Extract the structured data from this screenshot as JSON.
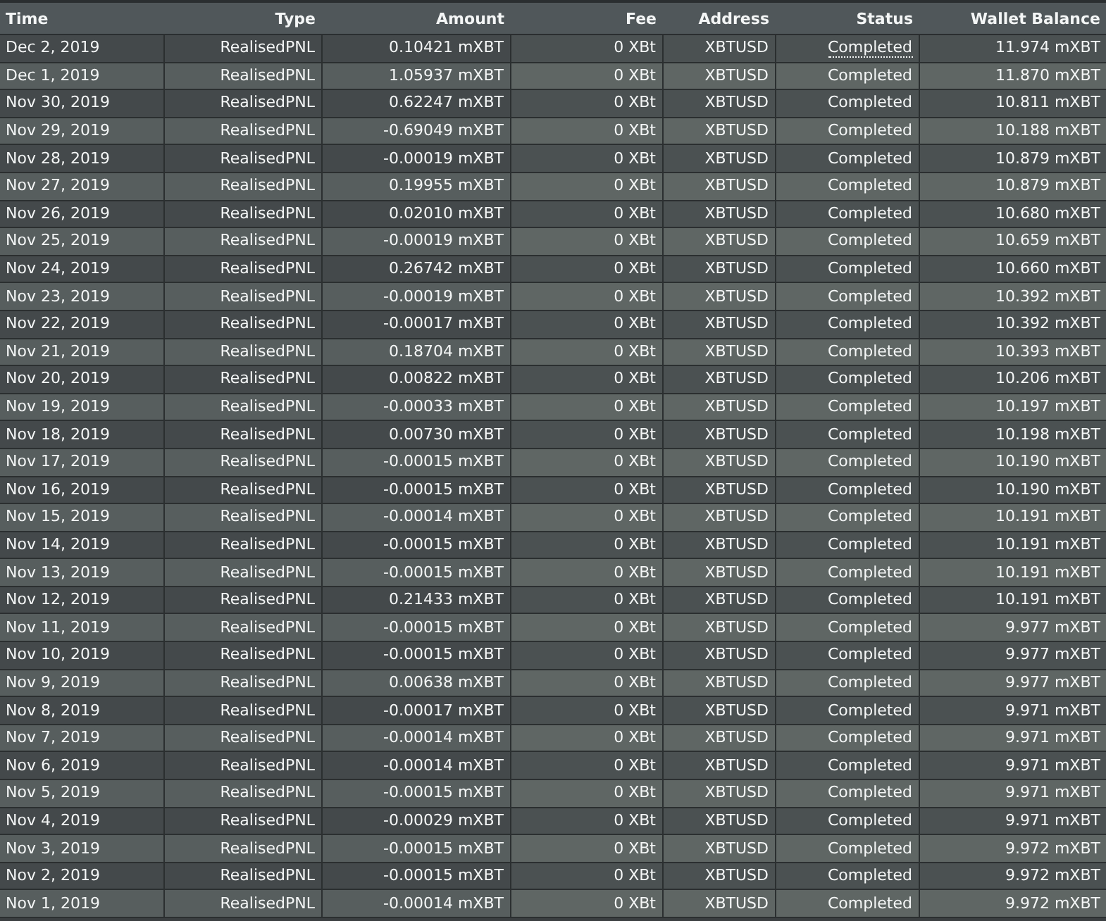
{
  "table": {
    "columns": [
      "Time",
      "Type",
      "Amount",
      "Fee",
      "Address",
      "Status",
      "Wallet Balance"
    ],
    "rows": [
      {
        "cells": [
          "Dec 2, 2019",
          "RealisedPNL",
          "0.10421 mXBT",
          "0 XBt",
          "XBTUSD",
          "Completed",
          "11.974 mXBT"
        ],
        "hovered": true
      },
      {
        "cells": [
          "Dec 1, 2019",
          "RealisedPNL",
          "1.05937 mXBT",
          "0 XBt",
          "XBTUSD",
          "Completed",
          "11.870 mXBT"
        ],
        "hovered": false
      },
      {
        "cells": [
          "Nov 30, 2019",
          "RealisedPNL",
          "0.62247 mXBT",
          "0 XBt",
          "XBTUSD",
          "Completed",
          "10.811 mXBT"
        ],
        "hovered": false
      },
      {
        "cells": [
          "Nov 29, 2019",
          "RealisedPNL",
          "-0.69049 mXBT",
          "0 XBt",
          "XBTUSD",
          "Completed",
          "10.188 mXBT"
        ],
        "hovered": false
      },
      {
        "cells": [
          "Nov 28, 2019",
          "RealisedPNL",
          "-0.00019 mXBT",
          "0 XBt",
          "XBTUSD",
          "Completed",
          "10.879 mXBT"
        ],
        "hovered": false
      },
      {
        "cells": [
          "Nov 27, 2019",
          "RealisedPNL",
          "0.19955 mXBT",
          "0 XBt",
          "XBTUSD",
          "Completed",
          "10.879 mXBT"
        ],
        "hovered": false
      },
      {
        "cells": [
          "Nov 26, 2019",
          "RealisedPNL",
          "0.02010 mXBT",
          "0 XBt",
          "XBTUSD",
          "Completed",
          "10.680 mXBT"
        ],
        "hovered": false
      },
      {
        "cells": [
          "Nov 25, 2019",
          "RealisedPNL",
          "-0.00019 mXBT",
          "0 XBt",
          "XBTUSD",
          "Completed",
          "10.659 mXBT"
        ],
        "hovered": false
      },
      {
        "cells": [
          "Nov 24, 2019",
          "RealisedPNL",
          "0.26742 mXBT",
          "0 XBt",
          "XBTUSD",
          "Completed",
          "10.660 mXBT"
        ],
        "hovered": false
      },
      {
        "cells": [
          "Nov 23, 2019",
          "RealisedPNL",
          "-0.00019 mXBT",
          "0 XBt",
          "XBTUSD",
          "Completed",
          "10.392 mXBT"
        ],
        "hovered": false
      },
      {
        "cells": [
          "Nov 22, 2019",
          "RealisedPNL",
          "-0.00017 mXBT",
          "0 XBt",
          "XBTUSD",
          "Completed",
          "10.392 mXBT"
        ],
        "hovered": false
      },
      {
        "cells": [
          "Nov 21, 2019",
          "RealisedPNL",
          "0.18704 mXBT",
          "0 XBt",
          "XBTUSD",
          "Completed",
          "10.393 mXBT"
        ],
        "hovered": false
      },
      {
        "cells": [
          "Nov 20, 2019",
          "RealisedPNL",
          "0.00822 mXBT",
          "0 XBt",
          "XBTUSD",
          "Completed",
          "10.206 mXBT"
        ],
        "hovered": false
      },
      {
        "cells": [
          "Nov 19, 2019",
          "RealisedPNL",
          "-0.00033 mXBT",
          "0 XBt",
          "XBTUSD",
          "Completed",
          "10.197 mXBT"
        ],
        "hovered": false
      },
      {
        "cells": [
          "Nov 18, 2019",
          "RealisedPNL",
          "0.00730 mXBT",
          "0 XBt",
          "XBTUSD",
          "Completed",
          "10.198 mXBT"
        ],
        "hovered": false
      },
      {
        "cells": [
          "Nov 17, 2019",
          "RealisedPNL",
          "-0.00015 mXBT",
          "0 XBt",
          "XBTUSD",
          "Completed",
          "10.190 mXBT"
        ],
        "hovered": false
      },
      {
        "cells": [
          "Nov 16, 2019",
          "RealisedPNL",
          "-0.00015 mXBT",
          "0 XBt",
          "XBTUSD",
          "Completed",
          "10.190 mXBT"
        ],
        "hovered": false
      },
      {
        "cells": [
          "Nov 15, 2019",
          "RealisedPNL",
          "-0.00014 mXBT",
          "0 XBt",
          "XBTUSD",
          "Completed",
          "10.191 mXBT"
        ],
        "hovered": false
      },
      {
        "cells": [
          "Nov 14, 2019",
          "RealisedPNL",
          "-0.00015 mXBT",
          "0 XBt",
          "XBTUSD",
          "Completed",
          "10.191 mXBT"
        ],
        "hovered": false
      },
      {
        "cells": [
          "Nov 13, 2019",
          "RealisedPNL",
          "-0.00015 mXBT",
          "0 XBt",
          "XBTUSD",
          "Completed",
          "10.191 mXBT"
        ],
        "hovered": false
      },
      {
        "cells": [
          "Nov 12, 2019",
          "RealisedPNL",
          "0.21433 mXBT",
          "0 XBt",
          "XBTUSD",
          "Completed",
          "10.191 mXBT"
        ],
        "hovered": false
      },
      {
        "cells": [
          "Nov 11, 2019",
          "RealisedPNL",
          "-0.00015 mXBT",
          "0 XBt",
          "XBTUSD",
          "Completed",
          "9.977 mXBT"
        ],
        "hovered": false
      },
      {
        "cells": [
          "Nov 10, 2019",
          "RealisedPNL",
          "-0.00015 mXBT",
          "0 XBt",
          "XBTUSD",
          "Completed",
          "9.977 mXBT"
        ],
        "hovered": false
      },
      {
        "cells": [
          "Nov 9, 2019",
          "RealisedPNL",
          "0.00638 mXBT",
          "0 XBt",
          "XBTUSD",
          "Completed",
          "9.977 mXBT"
        ],
        "hovered": false
      },
      {
        "cells": [
          "Nov 8, 2019",
          "RealisedPNL",
          "-0.00017 mXBT",
          "0 XBt",
          "XBTUSD",
          "Completed",
          "9.971 mXBT"
        ],
        "hovered": false
      },
      {
        "cells": [
          "Nov 7, 2019",
          "RealisedPNL",
          "-0.00014 mXBT",
          "0 XBt",
          "XBTUSD",
          "Completed",
          "9.971 mXBT"
        ],
        "hovered": false
      },
      {
        "cells": [
          "Nov 6, 2019",
          "RealisedPNL",
          "-0.00014 mXBT",
          "0 XBt",
          "XBTUSD",
          "Completed",
          "9.971 mXBT"
        ],
        "hovered": false
      },
      {
        "cells": [
          "Nov 5, 2019",
          "RealisedPNL",
          "-0.00015 mXBT",
          "0 XBt",
          "XBTUSD",
          "Completed",
          "9.971 mXBT"
        ],
        "hovered": false
      },
      {
        "cells": [
          "Nov 4, 2019",
          "RealisedPNL",
          "-0.00029 mXBT",
          "0 XBt",
          "XBTUSD",
          "Completed",
          "9.971 mXBT"
        ],
        "hovered": false
      },
      {
        "cells": [
          "Nov 3, 2019",
          "RealisedPNL",
          "-0.00015 mXBT",
          "0 XBt",
          "XBTUSD",
          "Completed",
          "9.972 mXBT"
        ],
        "hovered": false
      },
      {
        "cells": [
          "Nov 2, 2019",
          "RealisedPNL",
          "-0.00015 mXBT",
          "0 XBt",
          "XBTUSD",
          "Completed",
          "9.972 mXBT"
        ],
        "hovered": false
      },
      {
        "cells": [
          "Nov 1, 2019",
          "RealisedPNL",
          "-0.00014 mXBT",
          "0 XBt",
          "XBTUSD",
          "Completed",
          "9.972 mXBT"
        ],
        "hovered": false
      }
    ]
  }
}
